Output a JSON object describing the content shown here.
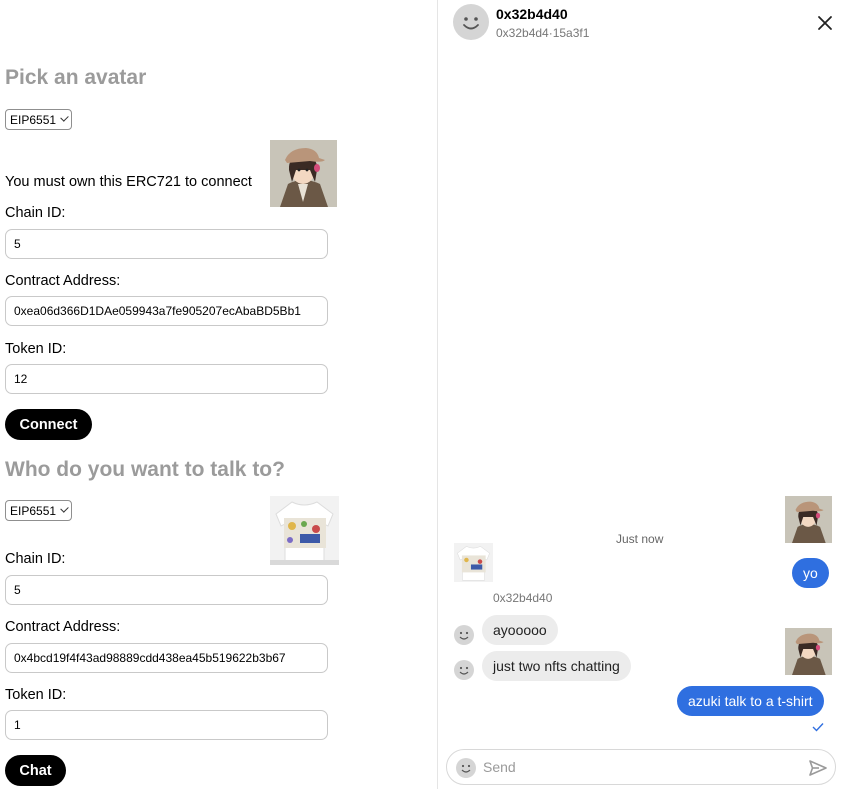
{
  "left": {
    "section1": {
      "title": "Pick an avatar",
      "standard": "EIP6551",
      "note": "You must own this ERC721 to connect",
      "chain_label": "Chain ID:",
      "chain_value": "5",
      "contract_label": "Contract Address:",
      "contract_value": "0xea06d366D1DAe059943a7fe905207ecAbaBD5Bb1",
      "token_label": "Token ID:",
      "token_value": "12",
      "button": "Connect"
    },
    "section2": {
      "title": "Who do you want to talk to?",
      "standard": "EIP6551",
      "chain_label": "Chain ID:",
      "chain_value": "5",
      "contract_label": "Contract Address:",
      "contract_value": "0x4bcd19f4f43ad98889cdd438ea45b519622b3b67",
      "token_label": "Token ID:",
      "token_value": "1",
      "button": "Chat"
    }
  },
  "chat": {
    "header": {
      "name": "0x32b4d40",
      "address": "0x32b4d4·15a3f1",
      "close_icon": "close-icon"
    },
    "timestamp": "Just now",
    "messages": [
      {
        "direction": "out",
        "text": "yo"
      },
      {
        "direction": "in",
        "sender": "0x32b4d40",
        "text": "ayooooo"
      },
      {
        "direction": "in",
        "text": "just two nfts chatting"
      },
      {
        "direction": "out",
        "text": "azuki talk to a t-shirt"
      }
    ],
    "composer": {
      "placeholder": "Send",
      "send_icon": "send-icon"
    }
  },
  "colors": {
    "accent": "#2f6fe0",
    "heading": "#9b9b9b",
    "button": "#000000"
  }
}
